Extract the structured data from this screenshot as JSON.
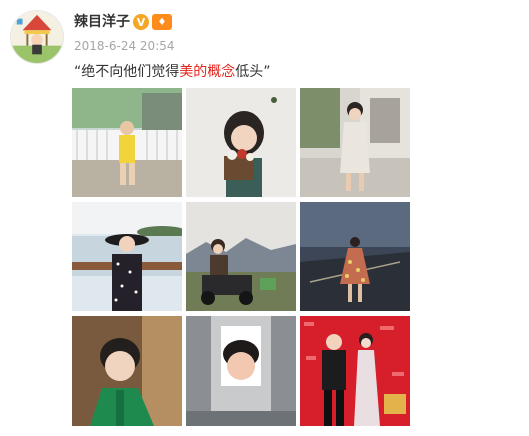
{
  "post": {
    "author": "辣目洋子",
    "verified_icon": "verified-v-icon",
    "level_icon": "member-level-icon",
    "timestamp": "2018-6-24 20:54",
    "text_parts": [
      "“绝不向他们觉得",
      "美的",
      "概念",
      "低头”"
    ],
    "highlight_color": "#e2231a"
  },
  "photos": [
    {
      "id": "photo-1",
      "desc": "girl in yellow top by white fence"
    },
    {
      "id": "photo-2",
      "desc": "girl holding bouquet against white wall"
    },
    {
      "id": "photo-3",
      "desc": "girl in light dress on street"
    },
    {
      "id": "photo-4",
      "desc": "girl in black hat by lake"
    },
    {
      "id": "photo-5",
      "desc": "girl on quad bike with mountains"
    },
    {
      "id": "photo-6",
      "desc": "girl in floral dress at dusk"
    },
    {
      "id": "photo-7",
      "desc": "girl in green dress close-up"
    },
    {
      "id": "photo-8",
      "desc": "girl face framed in doorway"
    },
    {
      "id": "photo-9",
      "desc": "red carpet event photo"
    }
  ]
}
